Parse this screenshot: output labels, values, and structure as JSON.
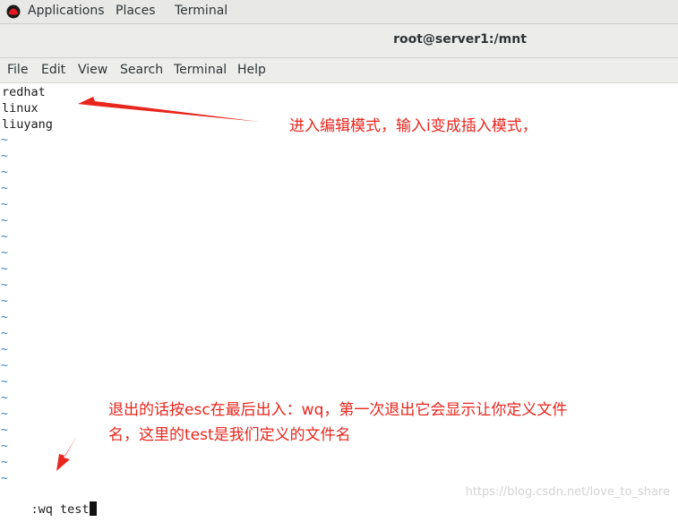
{
  "topbar": {
    "applications_label": "Applications",
    "places_label": "Places",
    "terminal_label": "Terminal",
    "logo_icon": "redhat-logo-icon"
  },
  "window": {
    "title": "root@server1:/mnt"
  },
  "menubar": {
    "items": [
      "File",
      "Edit",
      "View",
      "Search",
      "Terminal",
      "Help"
    ]
  },
  "editor": {
    "lines": [
      "redhat",
      "linux",
      "liuyang"
    ],
    "empty_line_marker": "~",
    "command_line": ":wq test"
  },
  "annotations": {
    "insert_mode_note": "进入编辑模式，输入i变成插入模式，",
    "exit_note_line1": "退出的话按esc在最后出入：wq，第一次退出它会显示让你定义文件",
    "exit_note_line2": "名，这里的test是我们定义的文件名",
    "annotation_color": "#e8261d"
  },
  "watermark": "https://blog.csdn.net/love_to_share"
}
